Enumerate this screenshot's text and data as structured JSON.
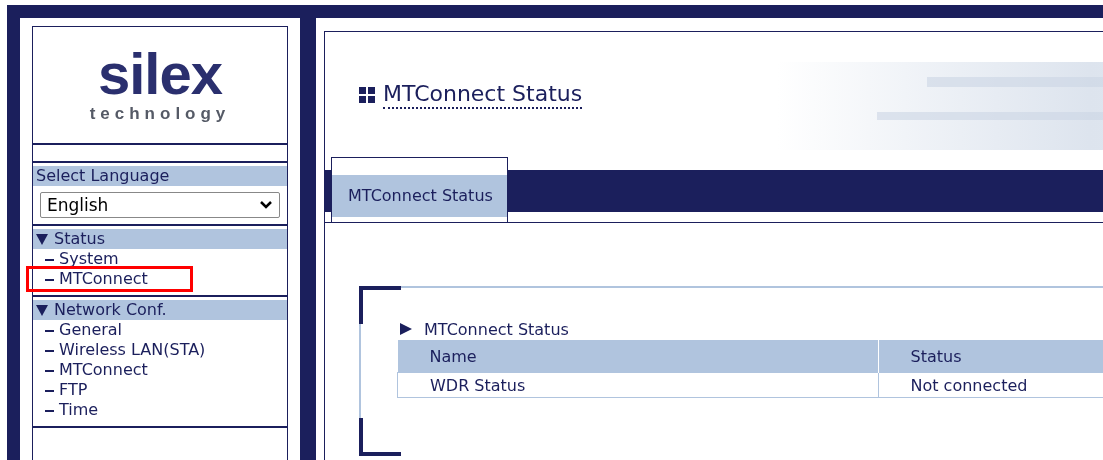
{
  "logo": {
    "name": "silex",
    "tagline": "technology"
  },
  "language": {
    "label": "Select Language",
    "value": "English"
  },
  "menu": [
    {
      "title": "Status",
      "expanded": true,
      "items": [
        {
          "label": "System",
          "highlighted": false
        },
        {
          "label": "MTConnect",
          "highlighted": true
        }
      ]
    },
    {
      "title": "Network Conf.",
      "expanded": true,
      "items": [
        {
          "label": "General",
          "highlighted": false
        },
        {
          "label": "Wireless LAN(STA)",
          "highlighted": false
        },
        {
          "label": "MTConnect",
          "highlighted": false
        },
        {
          "label": "FTP",
          "highlighted": false
        },
        {
          "label": "Time",
          "highlighted": false
        }
      ]
    }
  ],
  "page_title": "MTConnect Status",
  "tabs": [
    {
      "label": "MTConnect Status",
      "selected": true
    }
  ],
  "section": {
    "title": "MTConnect Status",
    "table": {
      "columns": [
        "Name",
        "Status"
      ],
      "rows": [
        [
          "WDR Status",
          "Not connected"
        ]
      ]
    }
  }
}
